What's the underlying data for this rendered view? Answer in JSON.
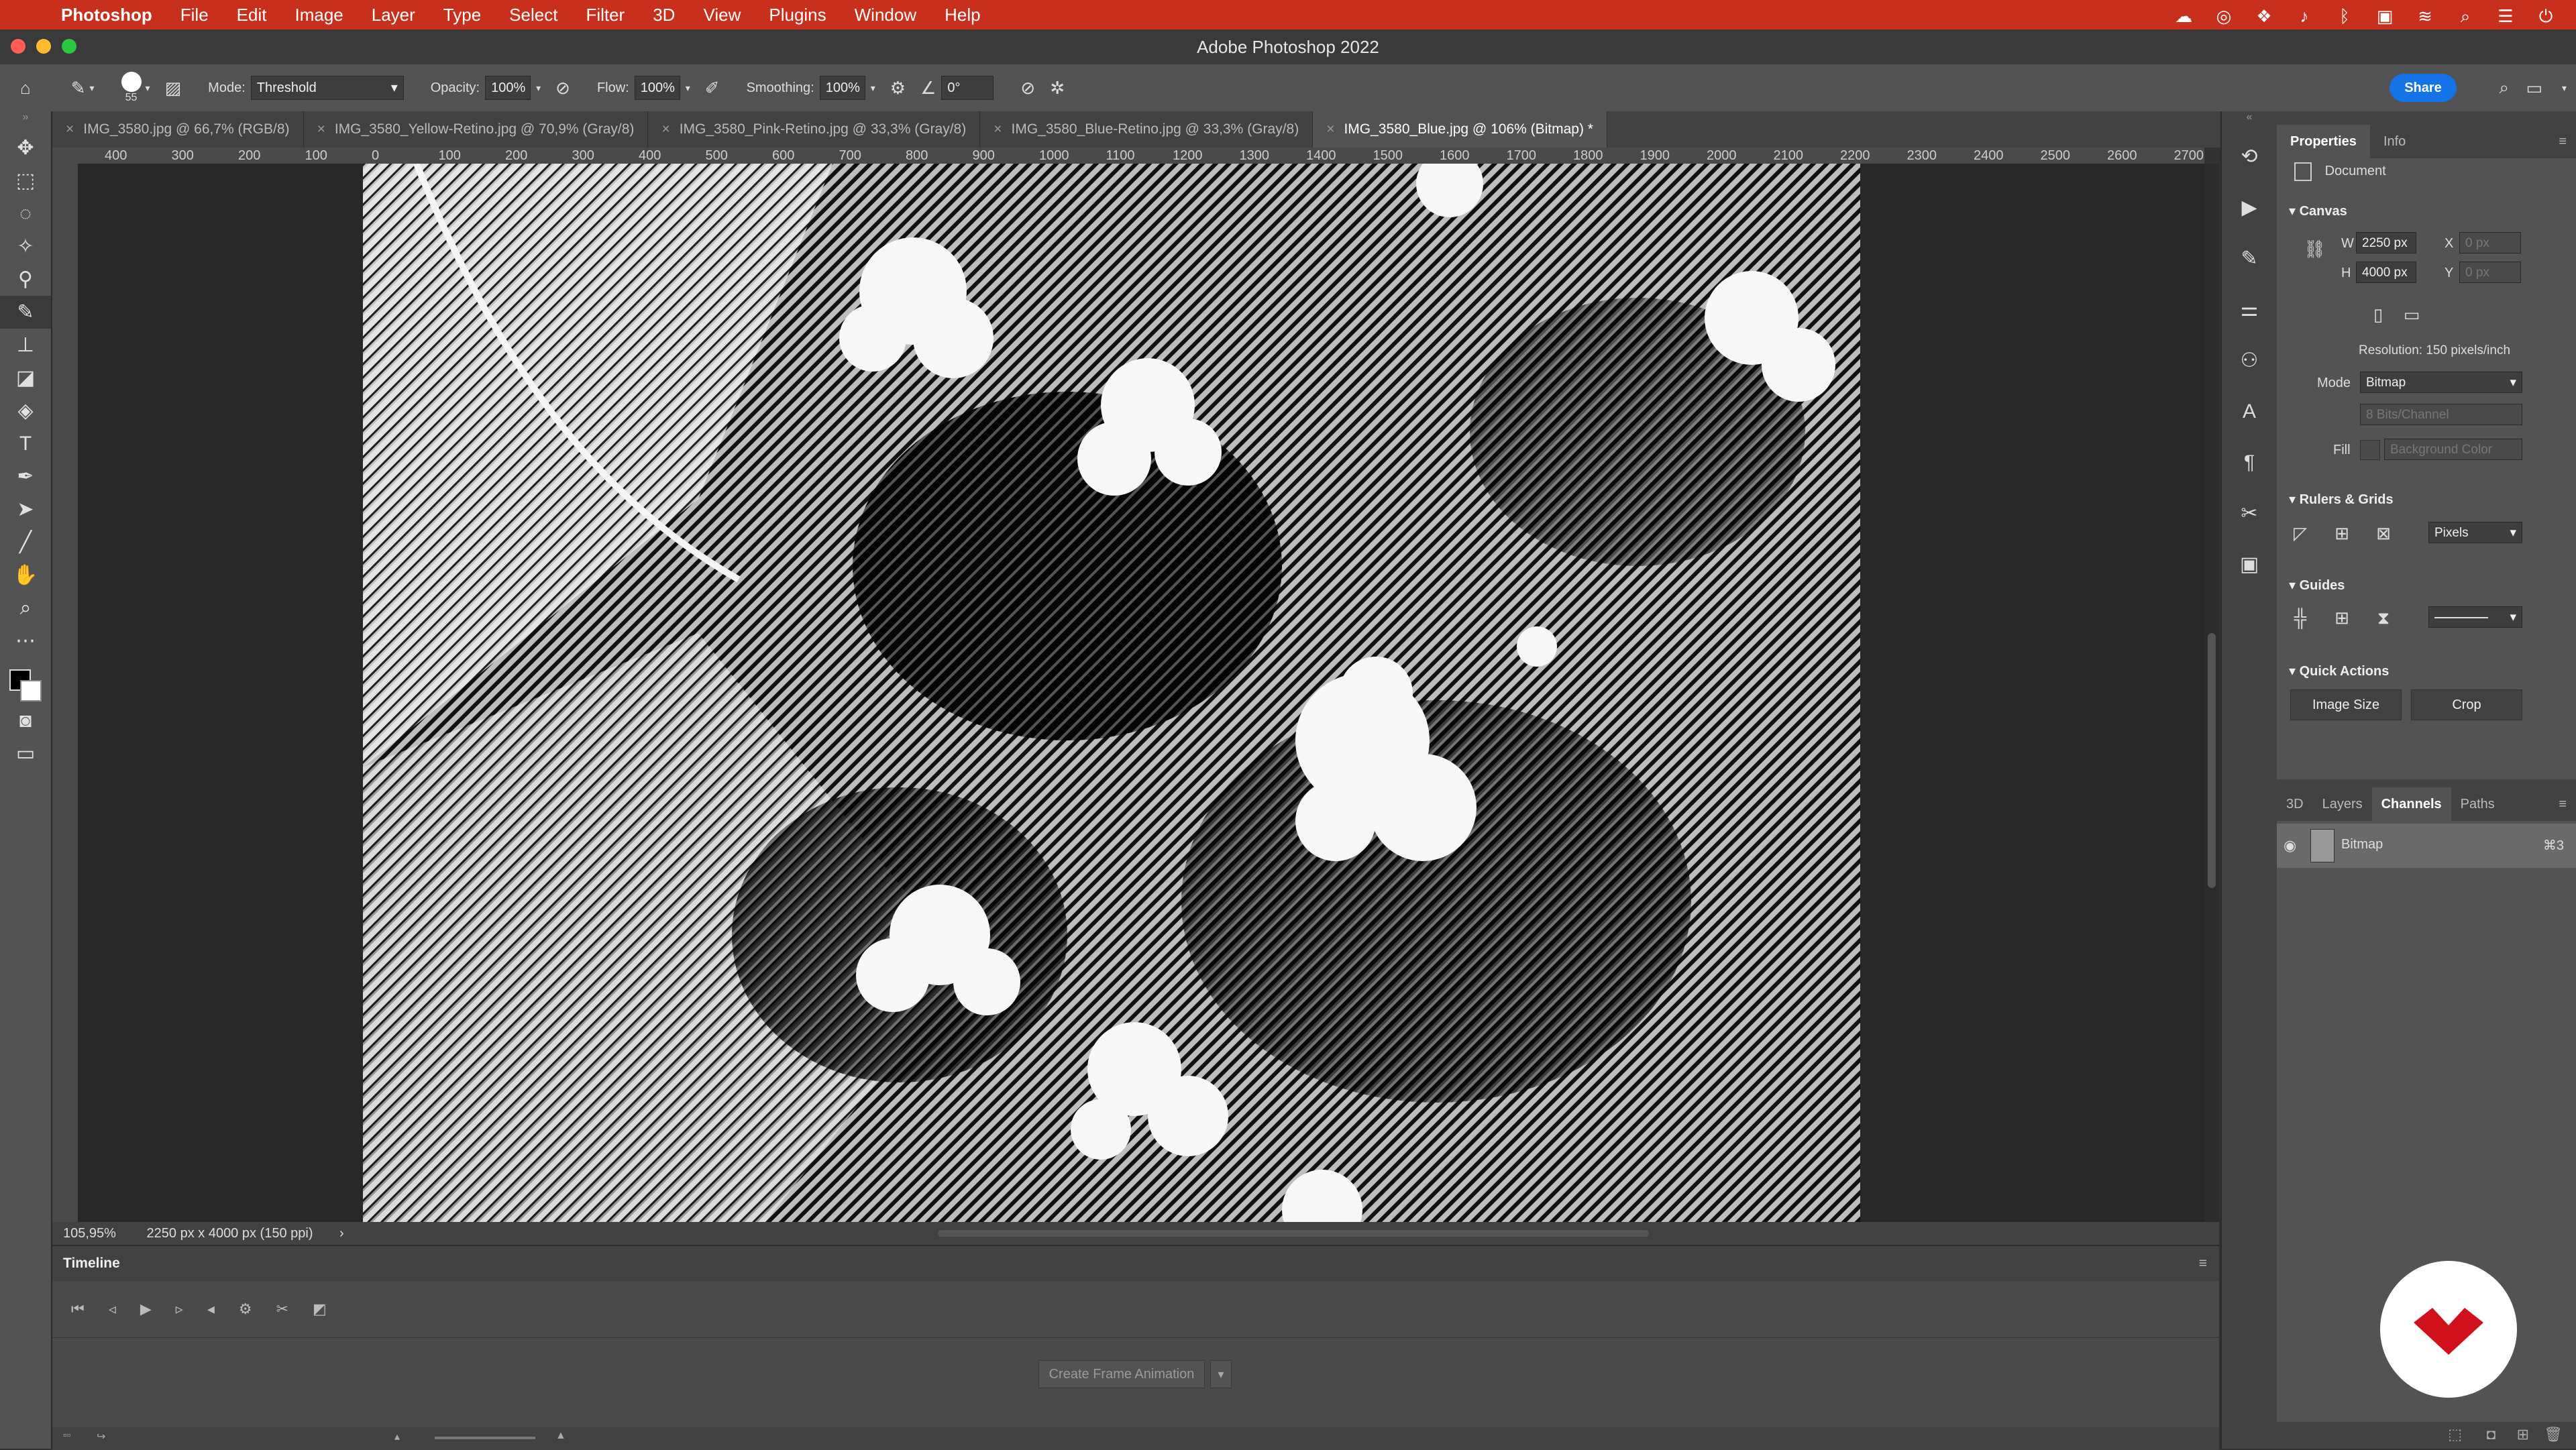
{
  "menubar": {
    "app": "Photoshop",
    "items": [
      "File",
      "Edit",
      "Image",
      "Layer",
      "Type",
      "Select",
      "Filter",
      "3D",
      "View",
      "Plugins",
      "Window",
      "Help"
    ]
  },
  "window": {
    "title": "Adobe Photoshop 2022"
  },
  "options": {
    "brush_size": "55",
    "mode_label": "Mode:",
    "mode_value": "Threshold",
    "opacity_label": "Opacity:",
    "opacity_value": "100%",
    "flow_label": "Flow:",
    "flow_value": "100%",
    "smoothing_label": "Smoothing:",
    "smoothing_value": "100%",
    "angle_value": "0°",
    "share_label": "Share"
  },
  "tabs": [
    {
      "label": "IMG_3580.jpg @ 66,7% (RGB/8)"
    },
    {
      "label": "IMG_3580_Yellow-Retino.jpg @ 70,9% (Gray/8)"
    },
    {
      "label": "IMG_3580_Pink-Retino.jpg @ 33,3% (Gray/8)"
    },
    {
      "label": "IMG_3580_Blue-Retino.jpg @ 33,3% (Gray/8)"
    },
    {
      "label": "IMG_3580_Blue.jpg @ 106% (Bitmap) *"
    }
  ],
  "ruler": {
    "h_labels": [
      "400",
      "300",
      "200",
      "100",
      "0",
      "100",
      "200",
      "300",
      "400",
      "500",
      "600",
      "700",
      "800",
      "900",
      "1000",
      "1100",
      "1200",
      "1300",
      "1400",
      "1500",
      "1600",
      "1700",
      "1800",
      "1900",
      "2000",
      "2100",
      "2200",
      "2300",
      "2400",
      "2500",
      "2600",
      "2700"
    ]
  },
  "status": {
    "zoom": "105,95%",
    "doc_info": "2250 px x 4000 px (150 ppi)"
  },
  "timeline": {
    "title": "Timeline",
    "create_button": "Create Frame Animation"
  },
  "properties": {
    "tabs": [
      "Properties",
      "Info"
    ],
    "document_label": "Document",
    "canvas_title": "Canvas",
    "w_label": "W",
    "w_value": "2250 px",
    "x_label": "X",
    "x_value": "0 px",
    "h_label": "H",
    "h_value": "4000 px",
    "y_label": "Y",
    "y_value": "0 px",
    "resolution": "Resolution: 150 pixels/inch",
    "mode_label": "Mode",
    "mode_value": "Bitmap",
    "bits_value": "8 Bits/Channel",
    "fill_label": "Fill",
    "fill_value": "Background Color",
    "rulers_title": "Rulers & Grids",
    "units_value": "Pixels",
    "guides_title": "Guides",
    "quick_title": "Quick Actions",
    "image_size_button": "Image Size",
    "crop_button": "Crop"
  },
  "lower_panel": {
    "tabs": [
      "3D",
      "Layers",
      "Channels",
      "Paths"
    ],
    "channel_name": "Bitmap",
    "channel_shortcut": "⌘3"
  },
  "colors": {
    "menubar": "#c8301d",
    "share": "#1473e6",
    "panel": "#535353"
  }
}
